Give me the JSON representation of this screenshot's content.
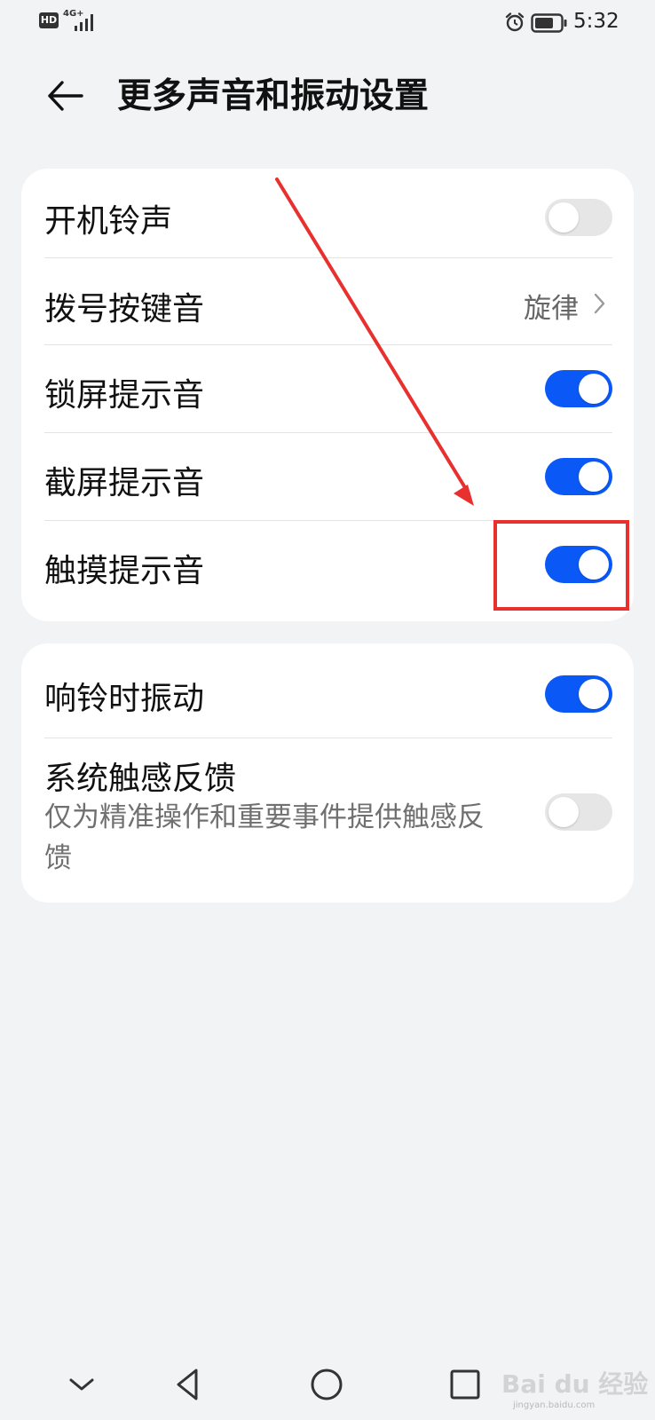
{
  "status_bar": {
    "hd": "HD",
    "network": "4G+",
    "time": "5:32"
  },
  "header": {
    "title": "更多声音和振动设置",
    "back_icon": "arrow-left-icon"
  },
  "sound_group": {
    "items": [
      {
        "label": "开机铃声",
        "control": "toggle",
        "on": false
      },
      {
        "label": "拨号按键音",
        "control": "value",
        "value": "旋律"
      },
      {
        "label": "锁屏提示音",
        "control": "toggle",
        "on": true
      },
      {
        "label": "截屏提示音",
        "control": "toggle",
        "on": true
      },
      {
        "label": "触摸提示音",
        "control": "toggle",
        "on": true
      }
    ]
  },
  "vibration_group": {
    "items": [
      {
        "label": "响铃时振动",
        "control": "toggle",
        "on": true
      },
      {
        "label": "系统触感反馈",
        "description": "仅为精准操作和重要事件提供触感反馈",
        "control": "toggle",
        "on": false
      }
    ]
  },
  "colors": {
    "accent": "#0a59f7",
    "annotation": "#e8302e",
    "background": "#f1f3f5"
  },
  "watermark": {
    "brand": "Bai du 经验",
    "url": "jingyan.baidu.com"
  }
}
